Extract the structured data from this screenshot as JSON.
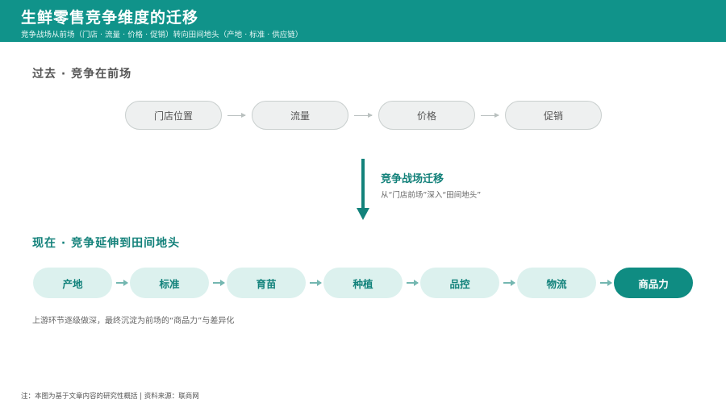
{
  "header": {
    "title": "生鲜零售竞争维度的迁移",
    "subtitle": "竞争战场从前场（门店 · 流量 · 价格 · 促销）转向田间地头（产地 · 标准 · 供应链）"
  },
  "past": {
    "label": "过去 · 竞争在前场",
    "steps": [
      "门店位置",
      "流量",
      "价格",
      "促销"
    ]
  },
  "shift": {
    "title": "竞争战场迁移",
    "subtitle": "从“门店前场”深入“田间地头”"
  },
  "now": {
    "label": "现在 · 竞争延伸到田间地头",
    "steps": [
      "产地",
      "标准",
      "育苗",
      "种植",
      "品控",
      "物流",
      "商品力"
    ]
  },
  "note": "上游环节逐级做深，最终沉淀为前场的“商品力”与差异化",
  "footer": "注：本图为基于文章内容的研究性概括 | 资料来源：联商网",
  "colors": {
    "brand": "#10938a",
    "accent_dark": "#0f8c82",
    "now_pill_bg": "#dcf1ee",
    "past_pill_bg": "#eef0f0"
  }
}
